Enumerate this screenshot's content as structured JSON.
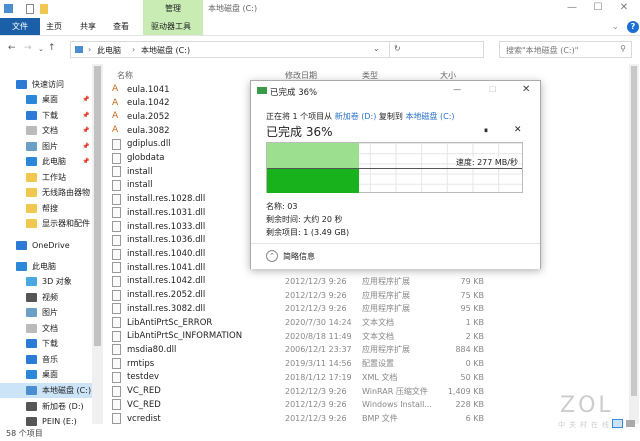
{
  "window": {
    "title": "本地磁盘 (C:)",
    "context_tab_group": "管理",
    "minimize": "—",
    "maximize": "☐",
    "close": "✕"
  },
  "ribbon": {
    "tabs": [
      "文件",
      "主页",
      "共享",
      "查看",
      "驱动器工具"
    ],
    "help": "?"
  },
  "address": {
    "crumbs": [
      "此电脑",
      "本地磁盘 (C:)"
    ],
    "search_placeholder": "搜索\"本地磁盘 (C:)\""
  },
  "sidebar": {
    "items": [
      {
        "label": "快速访问",
        "color": "#2b7bd6"
      },
      {
        "label": "桌面",
        "color": "#2b88d8"
      },
      {
        "label": "下载",
        "color": "#2b7bd6"
      },
      {
        "label": "文档",
        "color": "#bbb"
      },
      {
        "label": "图片",
        "color": "#6aa0c8"
      },
      {
        "label": "此电脑",
        "color": "#2b88d8"
      },
      {
        "label": "工作站",
        "color": "#f0c850"
      },
      {
        "label": "无线路由器物",
        "color": "#f0c850"
      },
      {
        "label": "帮搜",
        "color": "#f0c850"
      },
      {
        "label": "显示器和配件",
        "color": "#f0c850"
      },
      {
        "label": "OneDrive",
        "color": "#2b7bd6"
      },
      {
        "label": "此电脑",
        "color": "#2b88d8"
      },
      {
        "label": "3D 对象",
        "color": "#49a8e0"
      },
      {
        "label": "视频",
        "color": "#555"
      },
      {
        "label": "图片",
        "color": "#6aa0c8"
      },
      {
        "label": "文档",
        "color": "#bbb"
      },
      {
        "label": "下载",
        "color": "#2b7bd6"
      },
      {
        "label": "音乐",
        "color": "#2b7bd6"
      },
      {
        "label": "桌面",
        "color": "#2b88d8"
      },
      {
        "label": "本地磁盘 (C:)",
        "color": "#4a8ed0"
      },
      {
        "label": "新加卷 (D:)",
        "color": "#555"
      },
      {
        "label": "PEIN (E:)",
        "color": "#555"
      }
    ]
  },
  "columns": {
    "name": "名称",
    "date": "修改日期",
    "type": "类型",
    "size": "大小"
  },
  "files": [
    {
      "name": "eula.1041",
      "date": "",
      "type": "",
      "size": ""
    },
    {
      "name": "eula.1042",
      "date": "",
      "type": "",
      "size": ""
    },
    {
      "name": "eula.2052",
      "date": "",
      "type": "",
      "size": ""
    },
    {
      "name": "eula.3082",
      "date": "",
      "type": "",
      "size": ""
    },
    {
      "name": "gdiplus.dll",
      "date": "",
      "type": "",
      "size": ""
    },
    {
      "name": "globdata",
      "date": "",
      "type": "",
      "size": ""
    },
    {
      "name": "install",
      "date": "",
      "type": "",
      "size": ""
    },
    {
      "name": "install",
      "date": "",
      "type": "",
      "size": ""
    },
    {
      "name": "install.res.1028.dll",
      "date": "",
      "type": "",
      "size": ""
    },
    {
      "name": "install.res.1031.dll",
      "date": "",
      "type": "",
      "size": ""
    },
    {
      "name": "install.res.1033.dll",
      "date": "",
      "type": "",
      "size": ""
    },
    {
      "name": "install.res.1036.dll",
      "date": "",
      "type": "",
      "size": ""
    },
    {
      "name": "install.res.1040.dll",
      "date": "",
      "type": "",
      "size": ""
    },
    {
      "name": "install.res.1041.dll",
      "date": "",
      "type": "",
      "size": ""
    },
    {
      "name": "install.res.1042.dll",
      "date": "2012/12/3 9:26",
      "type": "应用程序扩展",
      "size": "79 KB"
    },
    {
      "name": "install.res.2052.dll",
      "date": "2012/12/3 9:26",
      "type": "应用程序扩展",
      "size": "75 KB"
    },
    {
      "name": "install.res.3082.dll",
      "date": "2012/12/3 9:26",
      "type": "应用程序扩展",
      "size": "95 KB"
    },
    {
      "name": "LibAntiPrtSc_ERROR",
      "date": "2020/7/30 14:24",
      "type": "文本文档",
      "size": "1 KB"
    },
    {
      "name": "LibAntiPrtSc_INFORMATION",
      "date": "2020/8/18 11:49",
      "type": "文本文档",
      "size": "2 KB"
    },
    {
      "name": "msdia80.dll",
      "date": "2006/12/1 23:37",
      "type": "应用程序扩展",
      "size": "884 KB"
    },
    {
      "name": "rmtips",
      "date": "2019/3/11 14:56",
      "type": "配置设置",
      "size": "0 KB"
    },
    {
      "name": "testdev",
      "date": "2018/1/12 17:19",
      "type": "XML 文档",
      "size": "50 KB"
    },
    {
      "name": "VC_RED",
      "date": "2012/12/3 9:26",
      "type": "WinRAR 压缩文件",
      "size": "1,409 KB"
    },
    {
      "name": "VC_RED",
      "date": "2012/12/3 9:26",
      "type": "Windows Install...",
      "size": "228 KB"
    },
    {
      "name": "vcredist",
      "date": "2012/12/3 9:26",
      "type": "BMP 文件",
      "size": "6 KB"
    }
  ],
  "status": "58 个项目",
  "dialog": {
    "title": "已完成 36%",
    "copy_prefix": "正在将 1 个项目从",
    "source": "新加卷 (D:)",
    "copy_mid": "复制到",
    "dest": "本地磁盘 (C:)",
    "heading": "已完成 36%",
    "progress": 0.36,
    "speed": "速度: 277 MB/秒",
    "name": "名称: 03",
    "time_left": "剩余时间: 大约 20 秒",
    "items_left": "剩余项目: 1 (3.49 GB)",
    "less_details": "简略信息",
    "pause": "⏸",
    "cancel": "✕",
    "minimize": "—",
    "maximize": "☐",
    "close": "✕",
    "color_light": "#9bdf8f",
    "color_dark": "#18b21d"
  },
  "watermark": {
    "logo": "ZOL",
    "sub": "中关村在线"
  }
}
